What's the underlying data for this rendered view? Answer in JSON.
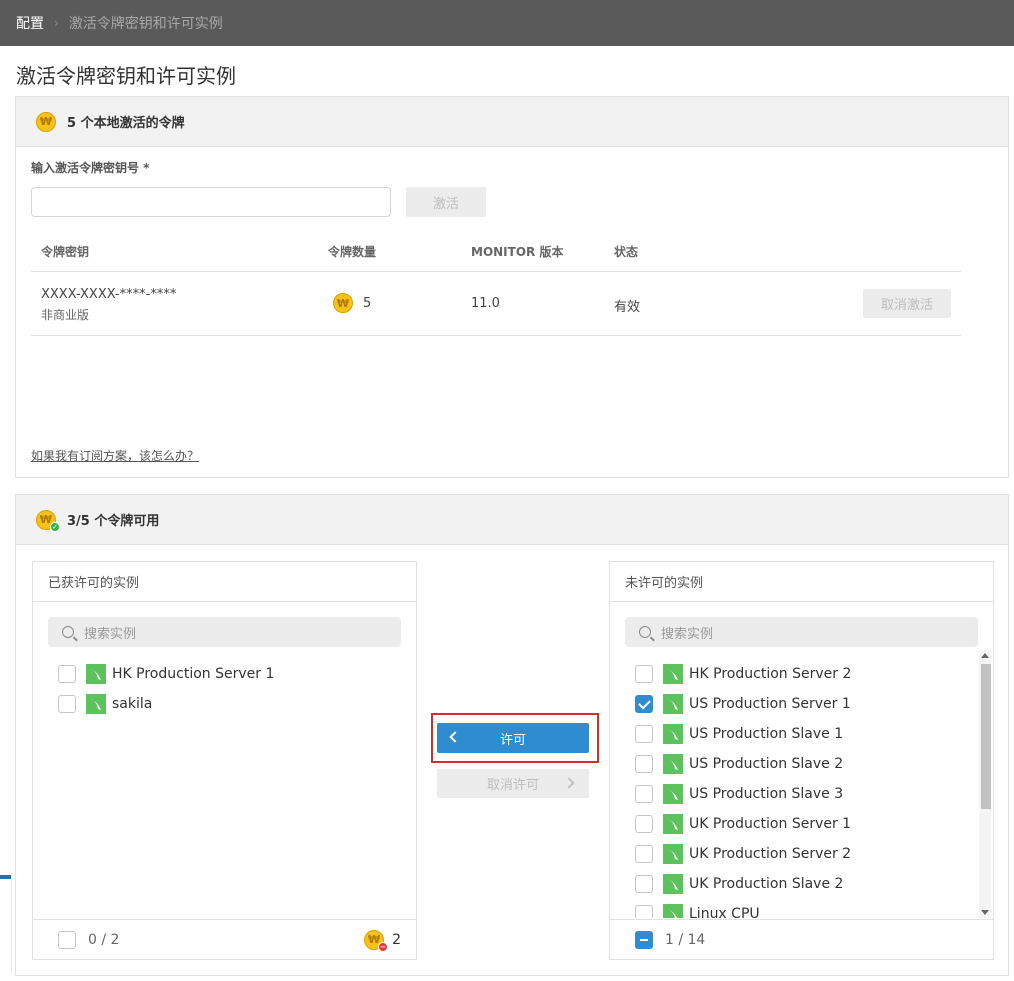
{
  "breadcrumb": {
    "root": "配置",
    "separator": "›",
    "current": "激活令牌密钥和许可实例"
  },
  "page_title": "激活令牌密钥和许可实例",
  "tokens_panel": {
    "coin_glyph": "₩",
    "header": "5 个本地激活的令牌",
    "input_label": "输入激活令牌密钥号 *",
    "input_value": "",
    "input_placeholder": "",
    "activate_label": "激活",
    "columns": [
      "令牌密钥",
      "令牌数量",
      "MONITOR 版本",
      "状态"
    ],
    "rows": [
      {
        "key": "XXXX-XXXX-****-****",
        "edition": "非商业版",
        "count": "5",
        "version": "11.0",
        "status": "有效",
        "action": "取消激活"
      }
    ],
    "subscription_link": "如果我有订阅方案，该怎么办？"
  },
  "licensing_panel": {
    "header": "3/5 个令牌可用",
    "licensed": {
      "title": "已获许可的实例",
      "search_placeholder": "搜索实例",
      "items": [
        {
          "name": "HK Production Server 1",
          "checked": false
        },
        {
          "name": "sakila",
          "checked": false
        }
      ],
      "footer_count": "0 / 2",
      "footer_tokens": "2"
    },
    "license_button": "许可",
    "unlicense_button": "取消许可",
    "unlicensed": {
      "title": "未许可的实例",
      "search_placeholder": "搜索实例",
      "items": [
        {
          "name": "HK Production Server 2",
          "checked": false
        },
        {
          "name": "US Production Server 1",
          "checked": true
        },
        {
          "name": "US Production Slave 1",
          "checked": false
        },
        {
          "name": "US Production Slave 2",
          "checked": false
        },
        {
          "name": "US Production Slave 3",
          "checked": false
        },
        {
          "name": "UK Production Server 1",
          "checked": false
        },
        {
          "name": "UK Production Server 2",
          "checked": false
        },
        {
          "name": "UK Production Slave 2",
          "checked": false
        },
        {
          "name": "Linux CPU",
          "checked": false
        }
      ],
      "footer_count": "1 / 14"
    }
  },
  "colors": {
    "topbar": "#5a5a5a",
    "accent": "#2f8ccf",
    "highlight": "#d0302c",
    "coin": "#f6c21a",
    "db_icon": "#5cc35c"
  }
}
